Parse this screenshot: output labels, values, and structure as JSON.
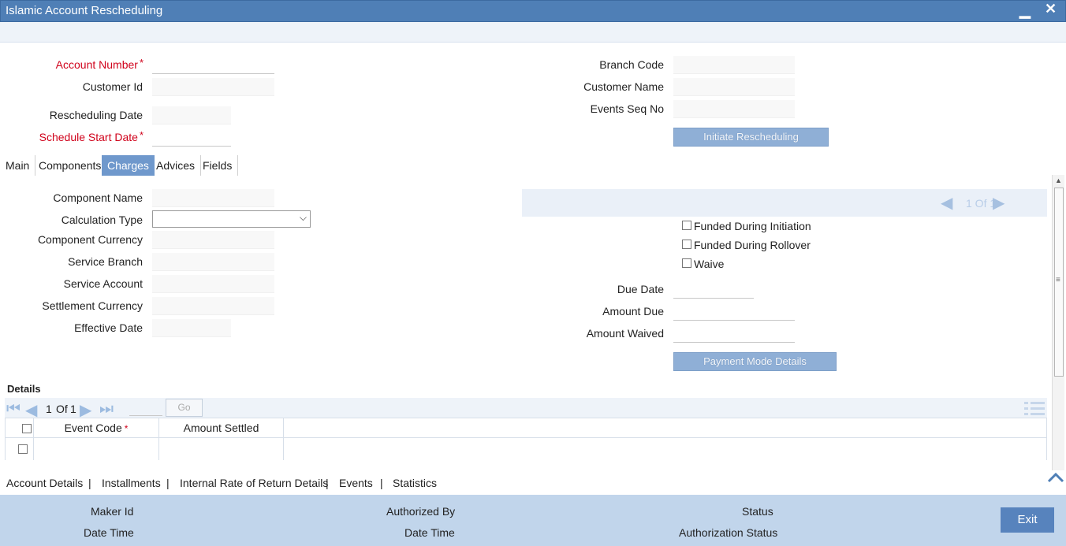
{
  "window": {
    "title": "Islamic Account Rescheduling",
    "minimize": "▁",
    "close": "✕"
  },
  "header": {
    "account_number_label": "Account Number",
    "customer_id_label": "Customer Id",
    "rescheduling_date_label": "Rescheduling Date",
    "schedule_start_date_label": "Schedule Start Date",
    "branch_code_label": "Branch Code",
    "customer_name_label": "Customer Name",
    "events_seq_no_label": "Events Seq No",
    "required_marker": "*",
    "initiate_button": "Initiate Rescheduling",
    "values": {
      "account_number": "",
      "customer_id": "",
      "rescheduling_date": "",
      "schedule_start_date": "",
      "branch_code": "",
      "customer_name": "",
      "events_seq_no": ""
    }
  },
  "tabs": [
    {
      "label": "Main",
      "active": false
    },
    {
      "label": "Components",
      "active": false
    },
    {
      "label": "Charges",
      "active": true
    },
    {
      "label": "Advices",
      "active": false
    },
    {
      "label": "Fields",
      "active": false
    }
  ],
  "charges": {
    "component_name_label": "Component Name",
    "calculation_type_label": "Calculation Type",
    "component_currency_label": "Component Currency",
    "service_branch_label": "Service Branch",
    "service_account_label": "Service Account",
    "settlement_currency_label": "Settlement Currency",
    "effective_date_label": "Effective Date",
    "pager": "1 Of 1",
    "funded_initiation_label": "Funded During Initiation",
    "funded_rollover_label": "Funded During Rollover",
    "waive_label": "Waive",
    "due_date_label": "Due Date",
    "amount_due_label": "Amount Due",
    "amount_waived_label": "Amount Waived",
    "payment_button": "Payment Mode Details"
  },
  "details": {
    "title": "Details",
    "page_current": "1",
    "page_of": "Of",
    "page_total": "1",
    "go_label": "Go",
    "columns": [
      "Event Code",
      "Amount Settled"
    ],
    "required_marker": "*"
  },
  "bottom_tabs": [
    "Account Details",
    "Installments",
    "Internal Rate of Return Details",
    "Events",
    "Statistics"
  ],
  "separator": "|",
  "footer": {
    "maker_id_label": "Maker Id",
    "date_time_label": "Date Time",
    "authorized_by_label": "Authorized By",
    "date_time2_label": "Date Time",
    "status_label": "Status",
    "authorization_status_label": "Authorization Status",
    "exit_button": "Exit"
  },
  "colors": {
    "titlebar": "#4f7fb6",
    "required": "#d0021b",
    "active_tab": "#6f98cc",
    "footer": "#c1d5eb"
  }
}
